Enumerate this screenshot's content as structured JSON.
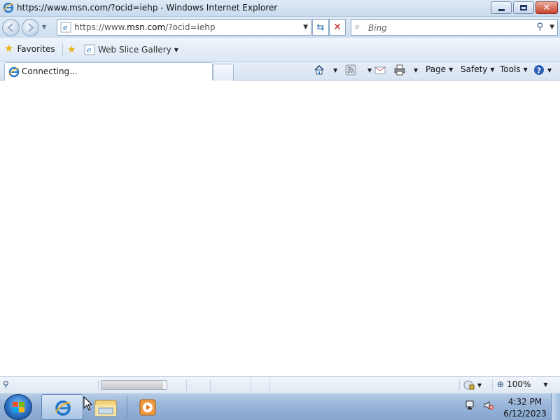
{
  "window": {
    "title": "https://www.msn.com/?ocid=iehp - Windows Internet Explorer"
  },
  "nav": {
    "address_prefix": "https://www.",
    "address_domain": "msn.com",
    "address_suffix": "/?ocid=iehp",
    "search_placeholder": "Bing"
  },
  "favorites": {
    "favorites_label": "Favorites",
    "web_slice_label": "Web Slice Gallery"
  },
  "tab": {
    "label": "Connecting..."
  },
  "command_bar": {
    "page_label": "Page",
    "safety_label": "Safety",
    "tools_label": "Tools"
  },
  "status": {
    "zoom": "100%",
    "progress_fraction": 0.95
  },
  "taskbar": {
    "time": "4:32 PM",
    "date": "6/12/2023"
  },
  "colors": {
    "ie_blue": "#2a78c8",
    "ie_gold": "#f0b429",
    "close_red": "#c8432b"
  }
}
